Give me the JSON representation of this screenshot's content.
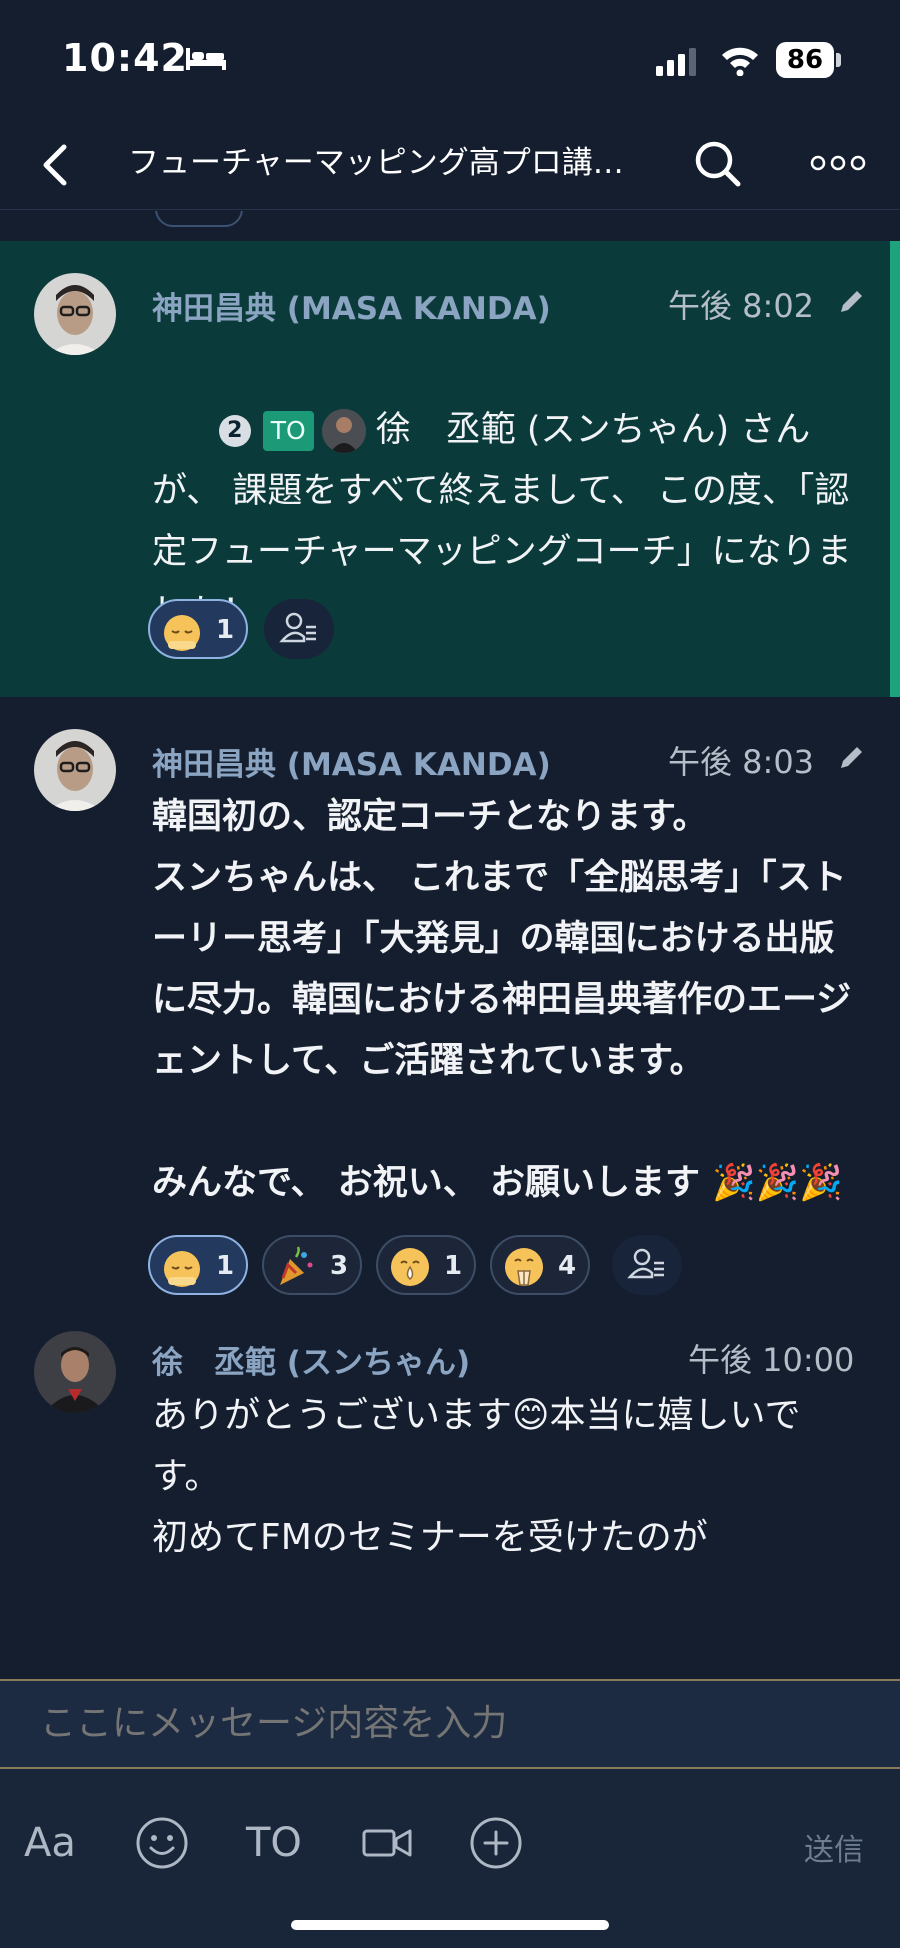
{
  "status_bar": {
    "time": "10:42",
    "battery": "86"
  },
  "header": {
    "title": "フューチャーマッピング高プロ講…"
  },
  "messages": [
    {
      "sender": "神田昌典 (MASA KANDA)",
      "time": "午後 8:02",
      "reply_count": "2",
      "to_label": "TO",
      "mention": "徐　丞範 (スンちゃん) さん",
      "line1_rest": "",
      "text": "が、 課題をすべて終えまして、 この度、「認定フューチャーマッピングコーチ」になりました！",
      "reactions": [
        {
          "emoji": "bowing-face",
          "count": "1"
        }
      ]
    },
    {
      "sender": "神田昌典 (MASA KANDA)",
      "time": "午後 8:03",
      "text": "韓国初の、認定コーチとなります。\nスンちゃんは、 これまで「全脳思考」「ストーリー思考」「大発見」の韓国における出版に尽力。韓国における神田昌典著作のエージェントして、ご活躍されています。\n\nみんなで、 お祝い、 お願いします 🎉🎉🎉",
      "reactions": [
        {
          "emoji": "bowing-face",
          "count": "1"
        },
        {
          "emoji": "party-popper",
          "count": "3"
        },
        {
          "emoji": "crying-face",
          "count": "1"
        },
        {
          "emoji": "clapping-face",
          "count": "4"
        }
      ]
    },
    {
      "sender": "徐　丞範 (スンちゃん)",
      "time": "午後 10:00",
      "text": "ありがとうございます😊本当に嬉しいです。",
      "text_partial": "初めてFMのセミナーを受けたのが"
    }
  ],
  "input": {
    "placeholder": "ここにメッセージ内容を入力"
  },
  "toolbar": {
    "font_label": "Aa",
    "to_label": "TO",
    "send_label": "送信"
  },
  "colors": {
    "background": "#141e2e",
    "highlight": "#0a3b3a",
    "accent": "#1fa37c",
    "sender": "#8aa4c2"
  }
}
